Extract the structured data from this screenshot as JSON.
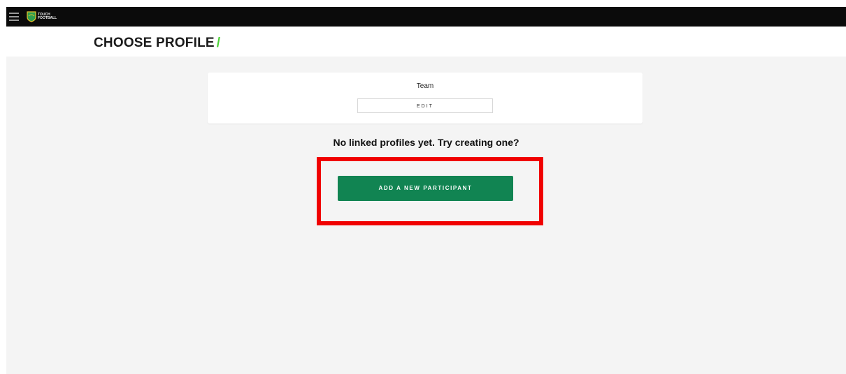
{
  "topbar": {
    "menu_icon": "hamburger-icon",
    "logo_icon": "touch-football-logo-icon",
    "logo_text": "TOUCH FOOTBALL"
  },
  "header": {
    "title": "CHOOSE PROFILE",
    "title_accent": "/"
  },
  "profile_card": {
    "name": "Team",
    "edit_label": "EDIT"
  },
  "empty_message": "No linked profiles yet. Try creating one?",
  "add_participant_label": "ADD A NEW PARTICIPANT",
  "colors": {
    "topbar": "#0b0b0b",
    "background": "#f4f4f4",
    "accent_green": "#4cd137",
    "button_green": "#118452",
    "highlight_red": "#f00000"
  }
}
